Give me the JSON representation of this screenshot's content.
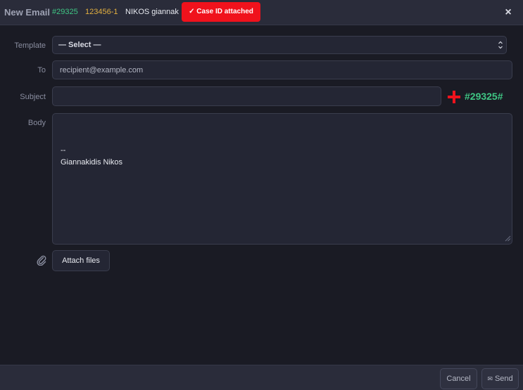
{
  "header": {
    "title": "New Email",
    "case_id": "#29325",
    "case_number": "123456-1",
    "contact_name": "NIKOS giannak",
    "badge": "✓ Case ID attached",
    "close_glyph": "×"
  },
  "form": {
    "template_label": "Template",
    "template_value": "— Select —",
    "template_chevron": "⌃⌄",
    "to_label": "To",
    "to_placeholder": "recipient@example.com",
    "to_value": "",
    "subject_label": "Subject",
    "subject_value": "",
    "subject_tag": "#29325#",
    "body_label": "Body",
    "body_value": "--\nGiannakidis Nikos",
    "attach_label": "Attach files"
  },
  "footer": {
    "cancel_label": "Cancel",
    "send_icon": "✉",
    "send_label": "Send"
  },
  "colors": {
    "background": "#1a1b24",
    "bar": "#2a2c3a",
    "accent_green": "#3fc684",
    "accent_yellow": "#e3b040",
    "badge_red": "#f0121c"
  },
  "icons": {
    "close": "close-icon",
    "plus": "plus-icon",
    "paperclip": "paperclip-icon",
    "envelope": "envelope-icon",
    "chevron": "chevron-up-down-icon"
  }
}
